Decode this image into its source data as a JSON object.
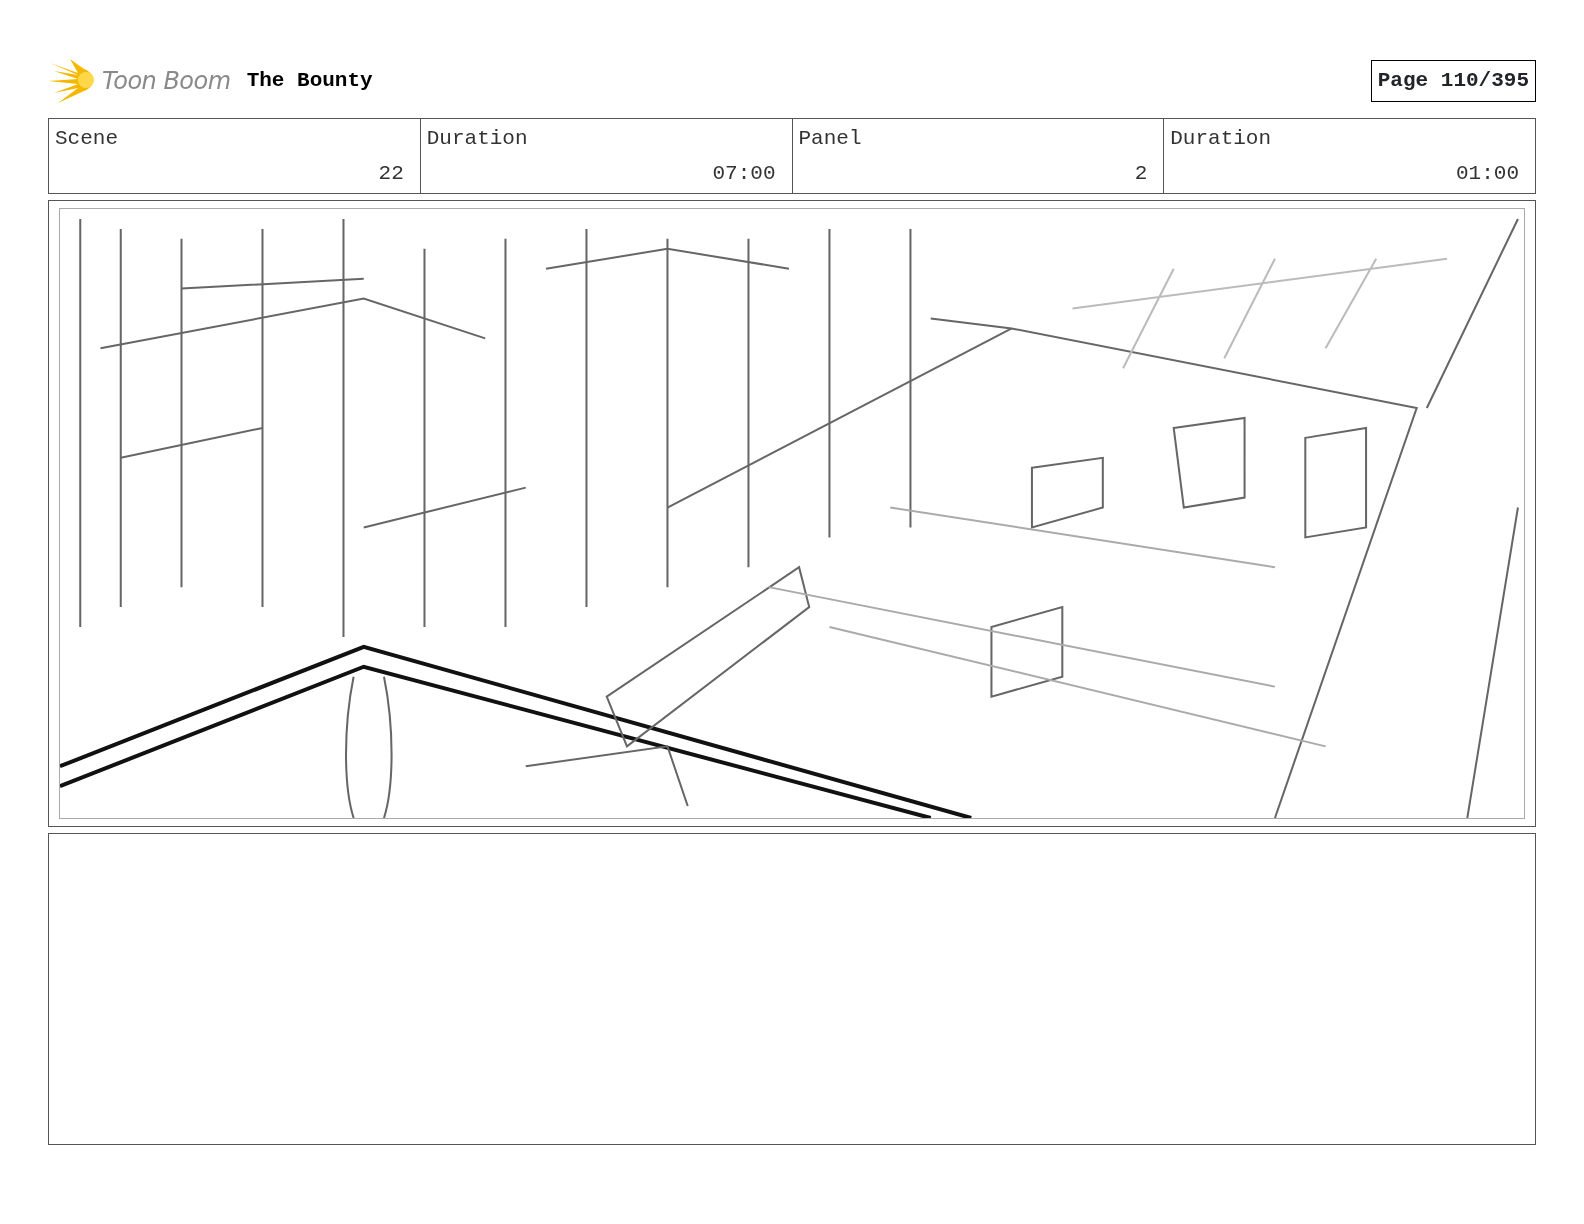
{
  "header": {
    "logo_text": "Toon Boom",
    "project_title": "The Bounty",
    "page_label": "Page 110/395"
  },
  "info_fields": [
    {
      "label": "Scene",
      "value": "22"
    },
    {
      "label": "Duration",
      "value": "07:00"
    },
    {
      "label": "Panel",
      "value": "2"
    },
    {
      "label": "Duration",
      "value": "01:00"
    }
  ]
}
